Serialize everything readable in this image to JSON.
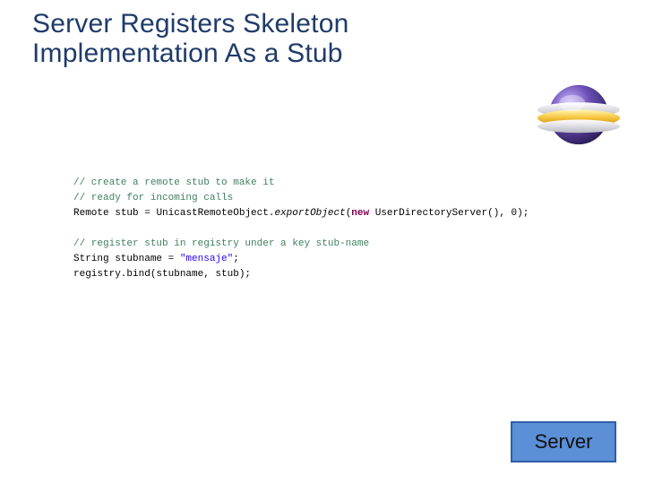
{
  "title_line1": "Server Registers Skeleton",
  "title_line2": "Implementation As a Stub",
  "logo": {
    "name": "eclipse-logo-icon"
  },
  "code": {
    "block1": {
      "c1": "// create a remote stub to make it",
      "c2": "// ready for incoming calls",
      "line": "Remote stub = UnicastRemoteObject.exportObject(new UserDirectoryServer(), 0);",
      "kw_new": "new",
      "type": "Remote",
      "var": "stub",
      "eq": " = ",
      "call_a": "UnicastRemoteObject.",
      "call_b": "exportObject",
      "paren_open": "(",
      "ctor": " UserDirectoryServer(), ",
      "zero": "0",
      "close": ");"
    },
    "block2": {
      "c1": "// register stub in registry under a key stub-name",
      "l2_a": "String stubname = ",
      "l2_str": "\"mensaje\"",
      "l2_b": ";",
      "l3": "registry.bind(stubname, stub);"
    }
  },
  "server_label": "Server"
}
